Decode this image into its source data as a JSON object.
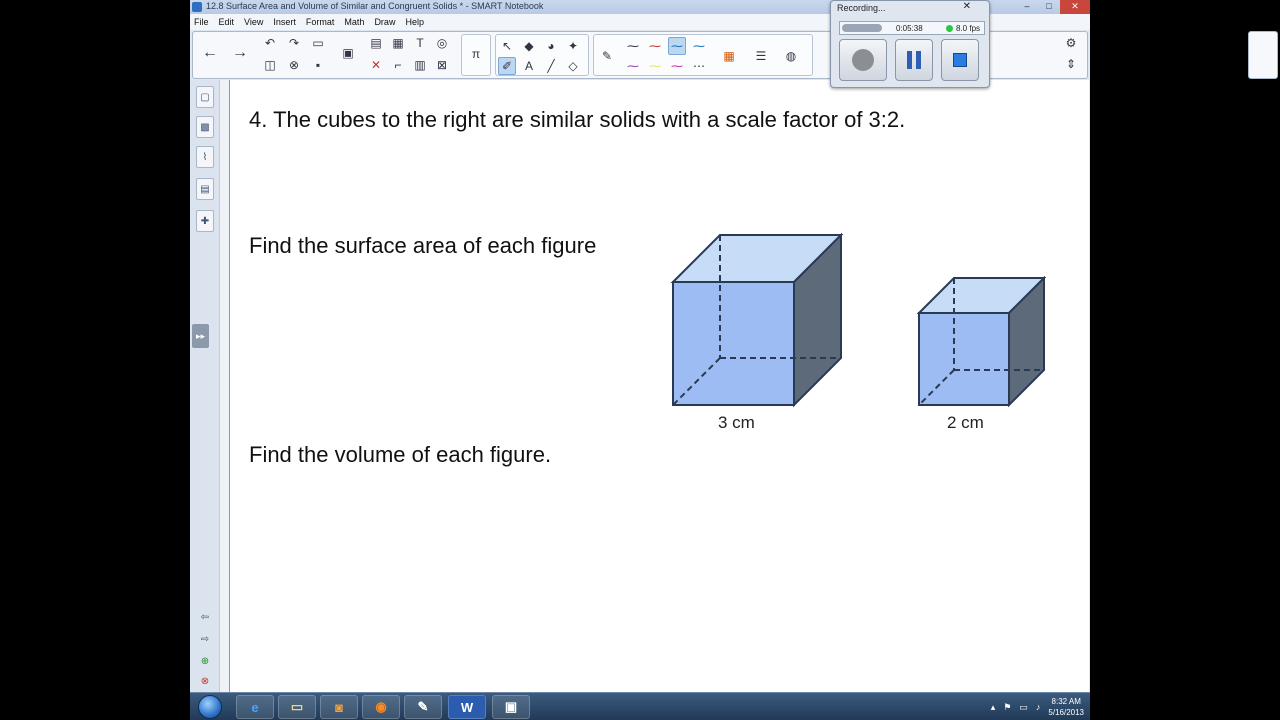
{
  "window": {
    "title": "12.8 Surface Area and Volume of Similar and Congruent Solids * - SMART Notebook",
    "controls": {
      "minimize": "–",
      "maximize": "□",
      "close": "✕"
    }
  },
  "menu": [
    "File",
    "Edit",
    "View",
    "Insert",
    "Format",
    "Math",
    "Draw",
    "Help"
  ],
  "toolbar_icons": {
    "back": "←",
    "forward": "→",
    "undo": "↶",
    "redo": "↷",
    "pi": "π",
    "select": "↖",
    "text": "A",
    "line": "╱",
    "eraser": "◇",
    "pen": "✎",
    "settings": "⚙",
    "move": "⇕"
  },
  "page": {
    "question": "4. The cubes to the right are similar solids with a scale factor of 3:2.",
    "surface_prompt": "Find the surface area of each figure",
    "volume_prompt": "Find the volume of each figure.",
    "big_cube_label": "3 cm",
    "small_cube_label": "2 cm",
    "cube_fill": "#9dbcf3",
    "cube_side": "#5d6a7a",
    "cube_top": "#c7dcf7"
  },
  "recorder": {
    "title": "Recording...",
    "time": "0:05:38",
    "fps": "8.0 fps",
    "close": "✕"
  },
  "taskbar": {
    "time": "8:32 AM",
    "date": "5/16/2013",
    "items": [
      "e",
      "▭",
      "◙",
      "◉",
      "✎",
      "W",
      "▣"
    ]
  }
}
